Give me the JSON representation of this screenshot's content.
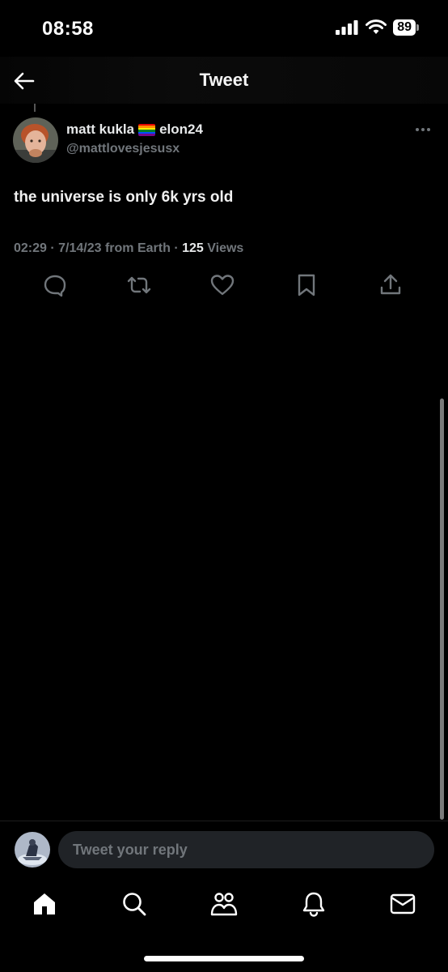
{
  "status_bar": {
    "time": "08:58",
    "battery": "89"
  },
  "header": {
    "title": "Tweet",
    "back_icon": "arrow-left-icon"
  },
  "tweet": {
    "author_name": "matt kukla",
    "author_name_suffix": "elon24",
    "flag_icon": "rainbow-flag-icon",
    "handle": "@mattlovesjesusx",
    "text": "the universe is only 6k yrs old",
    "meta_prefix": "02:29 · 7/14/23 from Earth · ",
    "views_count": "125",
    "views_label": " Views",
    "actions": [
      "reply-icon",
      "retweet-icon",
      "like-icon",
      "bookmark-icon",
      "share-icon"
    ]
  },
  "reply": {
    "placeholder": "Tweet your reply"
  },
  "tab_bar": {
    "tabs": [
      "home-icon",
      "search-icon",
      "communities-icon",
      "notifications-icon",
      "messages-icon"
    ]
  },
  "colors": {
    "background": "#000000",
    "text": "#e7e9ea",
    "muted": "#71767b",
    "input_bg": "#202327"
  }
}
